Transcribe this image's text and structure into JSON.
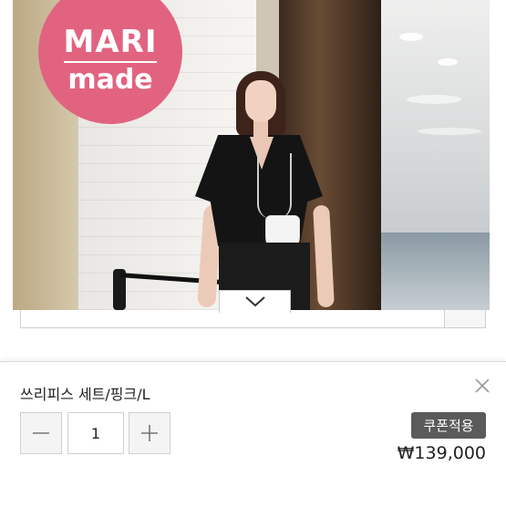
{
  "brand_badge": {
    "line1": "MARI",
    "line2": "made",
    "color": "#e2637f"
  },
  "product_image": {
    "icon": "product-photo"
  },
  "collapse_toggle": {
    "icon": "chevron-down-icon"
  },
  "hidden_select": {
    "text": ""
  },
  "option_panel": {
    "option_name": "쓰리피스 세트/핑크/L",
    "close_icon": "close-icon",
    "quantity": {
      "minus_icon": "minus-icon",
      "value": "1",
      "plus_icon": "plus-icon"
    },
    "coupon_label": "쿠폰적용",
    "price": "₩139,000"
  },
  "colors": {
    "coupon_bg": "#5a5a5a",
    "border": "#cfcfcf",
    "badge": "#e2637f"
  }
}
